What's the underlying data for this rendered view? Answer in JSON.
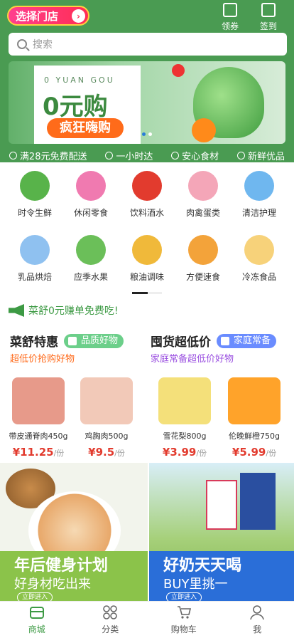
{
  "header": {
    "store_button": "选择门店",
    "actions": [
      {
        "label": "领券",
        "icon": "coupon-icon"
      },
      {
        "label": "签到",
        "icon": "calendar-icon"
      }
    ],
    "search_placeholder": "搜索"
  },
  "banner": {
    "subtitle": "0 YUAN GOU",
    "title": "0元购",
    "pill": "疯狂嗨购"
  },
  "features": [
    "满28元免费配送",
    "一小时达",
    "安心食材",
    "新鲜优品"
  ],
  "categories": [
    {
      "label": "时令生鲜",
      "color": "#58b34a"
    },
    {
      "label": "休闲零食",
      "color": "#f07ab0"
    },
    {
      "label": "饮料酒水",
      "color": "#e23b2e"
    },
    {
      "label": "肉禽蛋类",
      "color": "#f4a6b8"
    },
    {
      "label": "清洁护理",
      "color": "#6fb7ef"
    },
    {
      "label": "乳品烘焙",
      "color": "#8fc1f0"
    },
    {
      "label": "应季水果",
      "color": "#6bbf59"
    },
    {
      "label": "粮油调味",
      "color": "#f0b93a"
    },
    {
      "label": "方便速食",
      "color": "#f3a33a"
    },
    {
      "label": "冷冻食品",
      "color": "#f7d27a"
    }
  ],
  "notice": "菜舒0元赚单免费吃!",
  "deals": [
    {
      "title": "菜舒特惠",
      "tag": "品质好物",
      "tag_color": "#6ccf8a",
      "subtitle": "超低价抢购好物",
      "sub_color": "#ff6a1a"
    },
    {
      "title": "囤货超低价",
      "tag": "家庭常备",
      "tag_color": "#6a8cff",
      "subtitle": "家庭常备超低价好物",
      "sub_color": "#9a4fe0"
    }
  ],
  "products": [
    {
      "name": "带皮通脊肉450g",
      "price": "11.25",
      "unit": "/份",
      "color": "#e79a8a"
    },
    {
      "name": "鸡胸肉500g",
      "price": "9.5",
      "unit": "/份",
      "color": "#f2c9b8"
    },
    {
      "name": "雪花梨800g",
      "price": "3.99",
      "unit": "/份",
      "color": "#f4e07a"
    },
    {
      "name": "伦晚鲜橙750g",
      "price": "5.99",
      "unit": "/份",
      "color": "#ffa32a"
    }
  ],
  "currency": "¥",
  "promos": [
    {
      "title": "年后健身计划",
      "subtitle": "好身材吃出来",
      "button": "立即进入"
    },
    {
      "title": "好奶天天喝",
      "subtitle": "BUY里挑一",
      "button": "立即进入"
    }
  ],
  "tabs": [
    {
      "label": "商城",
      "icon": "store-icon",
      "active": true
    },
    {
      "label": "分类",
      "icon": "category-icon",
      "active": false
    },
    {
      "label": "购物车",
      "icon": "cart-icon",
      "active": false
    },
    {
      "label": "我",
      "icon": "user-icon",
      "active": false
    }
  ]
}
